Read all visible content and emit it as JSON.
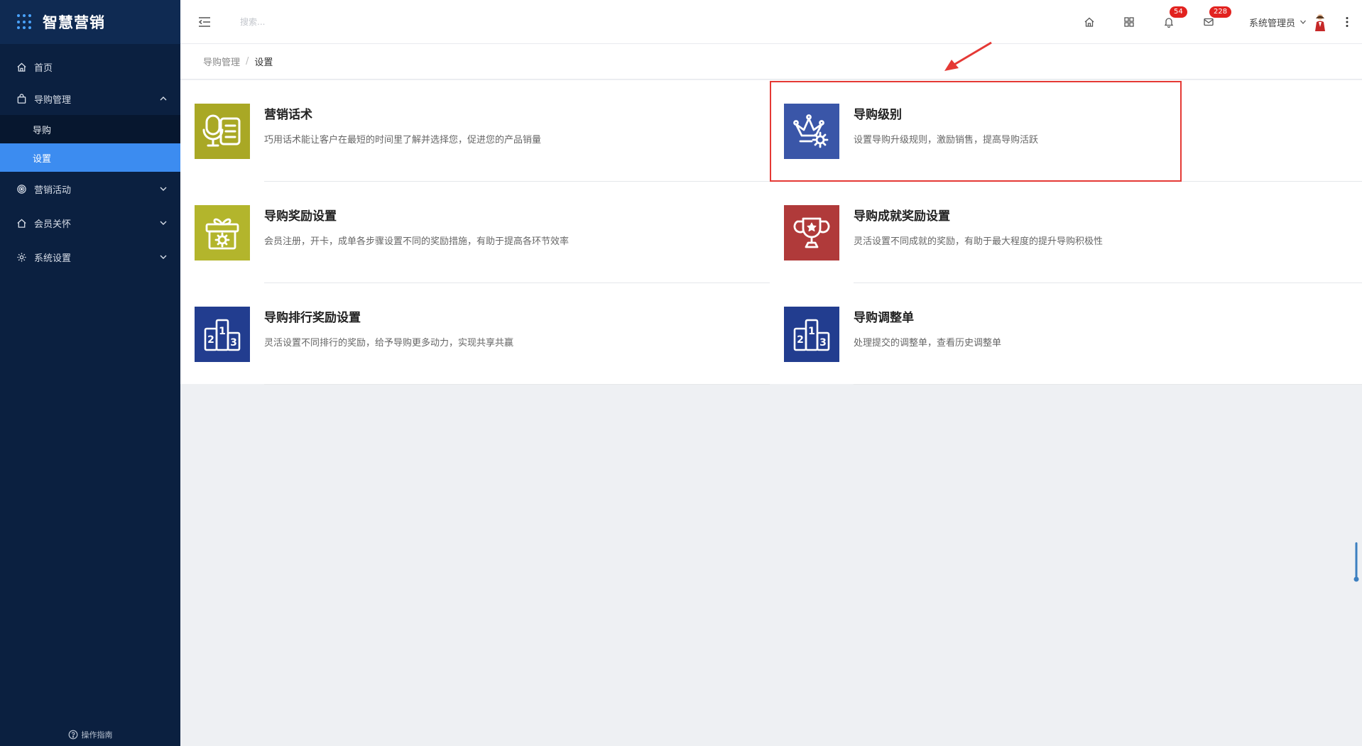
{
  "brand": {
    "title": "智慧营销"
  },
  "sidebar": {
    "items": [
      {
        "label": "首页",
        "icon": "home-icon"
      },
      {
        "label": "导购管理",
        "icon": "bag-icon",
        "expanded": true,
        "children": [
          {
            "label": "导购",
            "active": false
          },
          {
            "label": "设置",
            "active": true
          }
        ]
      },
      {
        "label": "营销活动",
        "icon": "target-icon"
      },
      {
        "label": "会员关怀",
        "icon": "home-heart-icon"
      },
      {
        "label": "系统设置",
        "icon": "gear-icon"
      }
    ],
    "guide_label": "操作指南"
  },
  "header": {
    "search_placeholder": "搜索...",
    "notifications_badge": "54",
    "messages_badge": "228",
    "user_name": "系统管理员"
  },
  "breadcrumb": {
    "parent": "导购管理",
    "separator": "/",
    "current": "设置"
  },
  "cards": [
    {
      "title": "营销话术",
      "desc": "巧用话术能让客户在最短的时间里了解并选择您，促进您的产品销量",
      "icon": "microphone-script-icon",
      "color": "#a9a825"
    },
    {
      "title": "导购级别",
      "desc": "设置导购升级规则，激励销售，提高导购活跃",
      "icon": "crown-gear-icon",
      "color": "#3a56a8"
    },
    {
      "title": "导购奖励设置",
      "desc": "会员注册，开卡，成单各步骤设置不同的奖励措施，有助于提高各环节效率",
      "icon": "gift-gear-icon",
      "color": "#b3b52c"
    },
    {
      "title": "导购成就奖励设置",
      "desc": "灵活设置不同成就的奖励，有助于最大程度的提升导购积极性",
      "icon": "trophy-icon",
      "color": "#b03a3a"
    },
    {
      "title": "导购排行奖励设置",
      "desc": "灵活设置不同排行的奖励，给予导购更多动力，实现共享共赢",
      "icon": "podium-icon",
      "color": "#223d8f"
    },
    {
      "title": "导购调整单",
      "desc": "处理提交的调整单，查看历史调整单",
      "icon": "podium-icon",
      "color": "#223d8f"
    }
  ],
  "colors": {
    "sidebar_bg": "#0b2040",
    "active_item": "#3c8cf0",
    "highlight": "#e53935"
  }
}
